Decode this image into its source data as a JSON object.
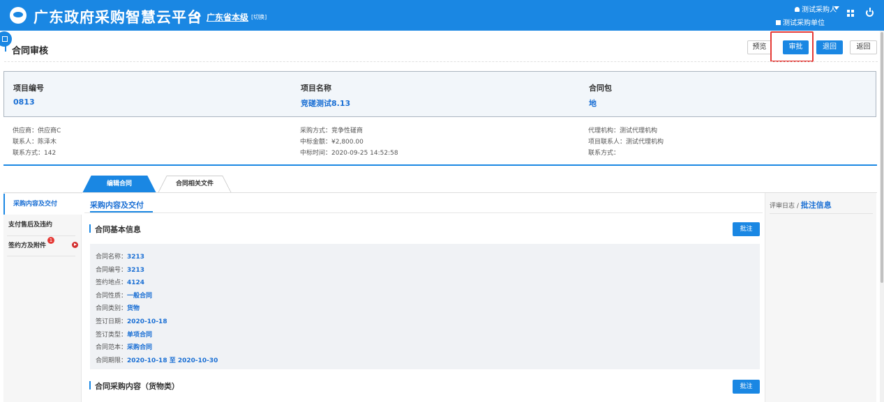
{
  "header": {
    "brand": "广东政府采购智慧云平台",
    "region": "广东省本级",
    "switch": "[切换]",
    "user": "测试采购人",
    "org": "测试采购单位"
  },
  "page": {
    "title": "合同审核",
    "buttons": {
      "preview": "预览",
      "approve": "审批",
      "reject": "退回",
      "back": "返回"
    }
  },
  "info": {
    "project_no_label": "项目编号",
    "project_no": "0813",
    "project_name_label": "项目名称",
    "project_name": "竞磋测试8.13",
    "package_label": "合同包",
    "package": "地",
    "supplier": "供应商：供应商C",
    "contact": "联系人：陈泽木",
    "contact_phone": "联系方式：142",
    "purchase_method": "采购方式：竞争性磋商",
    "award_amount": "中标金额：¥2,800.00",
    "award_time": "中标时间：2020-09-25 14:52:58",
    "agency": "代理机构：测试代理机构",
    "project_contact": "项目联系人：测试代理机构",
    "agency_phone": "联系方式："
  },
  "tabs": {
    "edit": "编辑合同",
    "files": "合同相关文件"
  },
  "sidebar": {
    "items": [
      {
        "label": "采购内容及交付"
      },
      {
        "label": "支付售后及违约"
      },
      {
        "label": "签约方及附件"
      }
    ],
    "badge": "1"
  },
  "content": {
    "tab_title": "采购内容及交付",
    "section1": "合同基本信息",
    "section2": "合同采购内容（货物类）",
    "note_button": "批注",
    "fields": [
      {
        "label": "合同名称：",
        "value": "3213"
      },
      {
        "label": "合同编号：",
        "value": "3213"
      },
      {
        "label": "签约地点：",
        "value": "4124"
      },
      {
        "label": "合同性质：",
        "value": "一般合同"
      },
      {
        "label": "合同类别：",
        "value": "货物"
      },
      {
        "label": "签订日期：",
        "value": "2020-10-18"
      },
      {
        "label": "签订类型：",
        "value": "单项合同"
      },
      {
        "label": "合同范本：",
        "value": "采购合同"
      },
      {
        "label": "合同期限：",
        "value": "2020-10-18 至 2020-10-30"
      }
    ]
  },
  "right_panel": {
    "log": "评审日志 / ",
    "notes": "批注信息"
  }
}
